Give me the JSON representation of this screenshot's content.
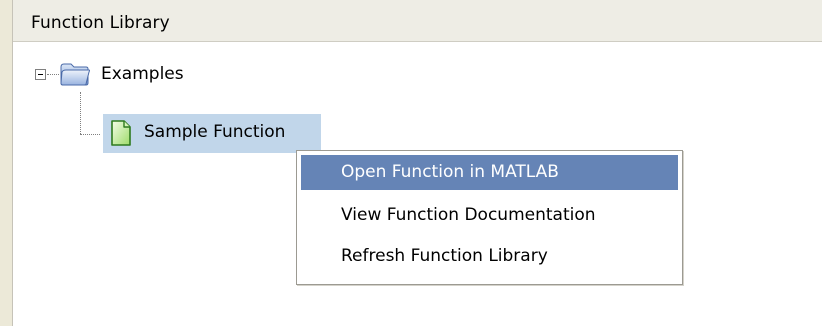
{
  "panel": {
    "title": "Function Library"
  },
  "tree": {
    "root": {
      "label": "Examples",
      "expanded": true,
      "expander_symbol": "minus",
      "icon": "folder-icon"
    },
    "children": [
      {
        "label": "Sample Function",
        "selected": true,
        "icon": "function-file-icon"
      }
    ]
  },
  "context_menu": {
    "items": [
      {
        "label": "Open Function in MATLAB",
        "highlighted": true
      },
      {
        "label": "View Function Documentation",
        "highlighted": false
      },
      {
        "label": "Refresh Function Library",
        "highlighted": false
      }
    ]
  },
  "colors": {
    "header_bg": "#eeede5",
    "selection_bg": "#c1d6ea",
    "menu_highlight": "#6584b6",
    "file_icon_green": "#a8e07a"
  }
}
